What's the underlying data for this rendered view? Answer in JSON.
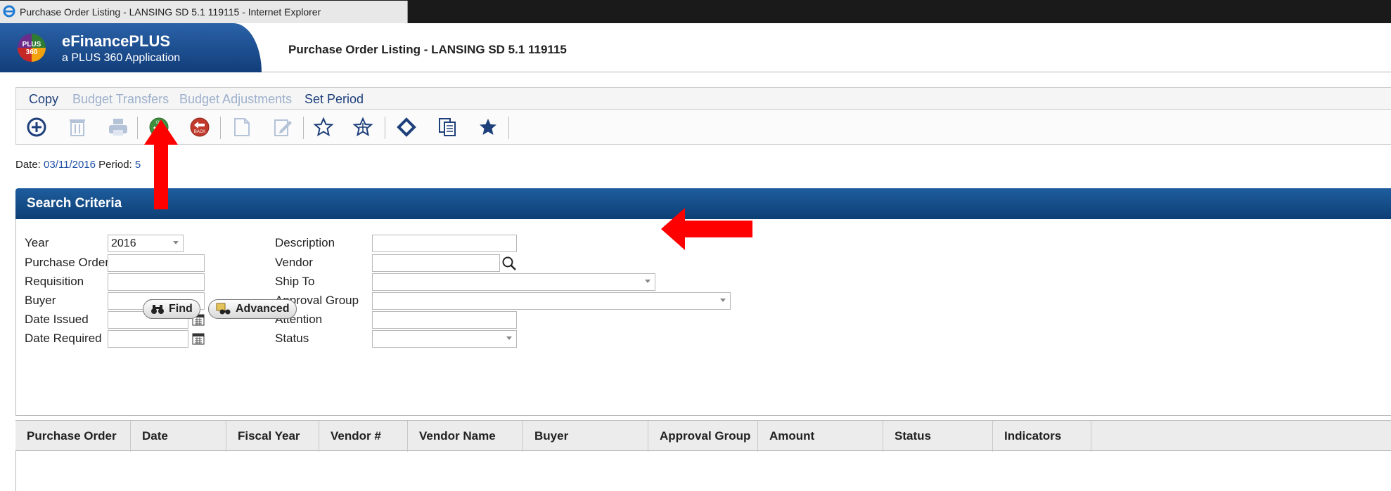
{
  "window": {
    "title": "Purchase Order Listing - LANSING SD 5.1 119115 - Internet Explorer"
  },
  "app": {
    "logo_top": "PLUS",
    "logo_bottom": "360",
    "name": "eFinancePLUS",
    "subtitle": "a PLUS 360 Application",
    "page_title": "Purchase Order Listing - LANSING SD 5.1 119115"
  },
  "menu": [
    {
      "label": "Copy",
      "enabled": true
    },
    {
      "label": "Budget Transfers",
      "enabled": false
    },
    {
      "label": "Budget Adjustments",
      "enabled": false
    },
    {
      "label": "Set Period",
      "enabled": true
    }
  ],
  "toolbar": [
    {
      "icon": "add-icon",
      "enabled": true
    },
    {
      "icon": "delete-icon",
      "enabled": false
    },
    {
      "icon": "print-icon",
      "enabled": false
    },
    {
      "icon": "ok-icon",
      "label": "OK",
      "enabled": true
    },
    {
      "icon": "back-icon",
      "label": "BACK",
      "enabled": true
    },
    {
      "icon": "document-icon",
      "enabled": false
    },
    {
      "icon": "edit-document-icon",
      "enabled": false
    },
    {
      "icon": "star-outline-icon",
      "enabled": true
    },
    {
      "icon": "star-outline-icon",
      "enabled": true
    },
    {
      "icon": "diamond-icon",
      "enabled": true
    },
    {
      "icon": "copy-icon",
      "enabled": true
    },
    {
      "icon": "star-filled-icon",
      "enabled": true
    }
  ],
  "status": {
    "date_label": "Date:",
    "date_value": "03/11/2016",
    "period_label": "Period:",
    "period_value": "5"
  },
  "search": {
    "title": "Search Criteria",
    "fields": {
      "year_label": "Year",
      "year_value": "2016",
      "purchase_order_label": "Purchase Order",
      "requisition_label": "Requisition",
      "buyer_label": "Buyer",
      "date_issued_label": "Date Issued",
      "date_required_label": "Date Required",
      "description_label": "Description",
      "vendor_label": "Vendor",
      "ship_to_label": "Ship To",
      "approval_group_label": "Approval Group",
      "attention_label": "Attention",
      "status_label": "Status"
    },
    "find_label": "Find",
    "advanced_label": "Advanced"
  },
  "grid": {
    "columns": [
      "Purchase Order",
      "Date",
      "Fiscal Year",
      "Vendor #",
      "Vendor Name",
      "Buyer",
      "Approval Group",
      "Amount",
      "Status",
      "Indicators"
    ]
  },
  "colors": {
    "header_blue": "#1e5d9e",
    "menu_enabled": "#1d3f7a",
    "menu_disabled": "#9db0cc",
    "annotation_arrow": "#ff0000"
  }
}
